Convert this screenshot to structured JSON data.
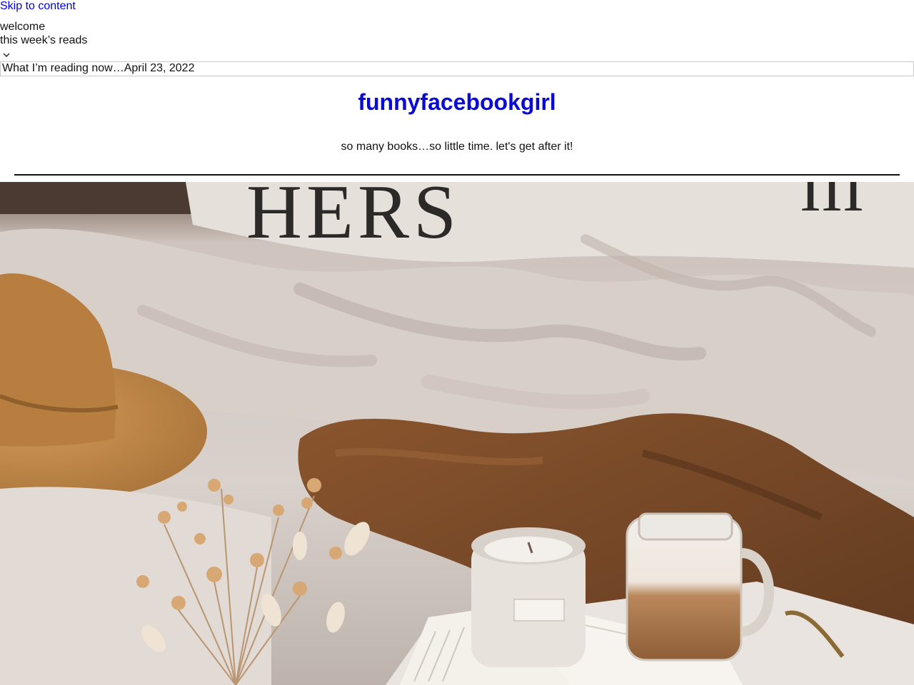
{
  "skip_link": "Skip to content",
  "nav": {
    "items": [
      "welcome",
      "this week’s reads"
    ]
  },
  "dropdown": {
    "selected": "What I’m reading now…April 23, 2022"
  },
  "site": {
    "title": "funnyfacebookgirl",
    "tagline": "so many books…so little time. let's get after it!"
  },
  "hero": {
    "pillow_lettering": "HERS",
    "colors": {
      "bedding": "#d9d1cc",
      "hat": "#c48a48",
      "blanket": "#7a4a28",
      "candle": "#e8e2dc",
      "drink": "#b9875a"
    }
  }
}
